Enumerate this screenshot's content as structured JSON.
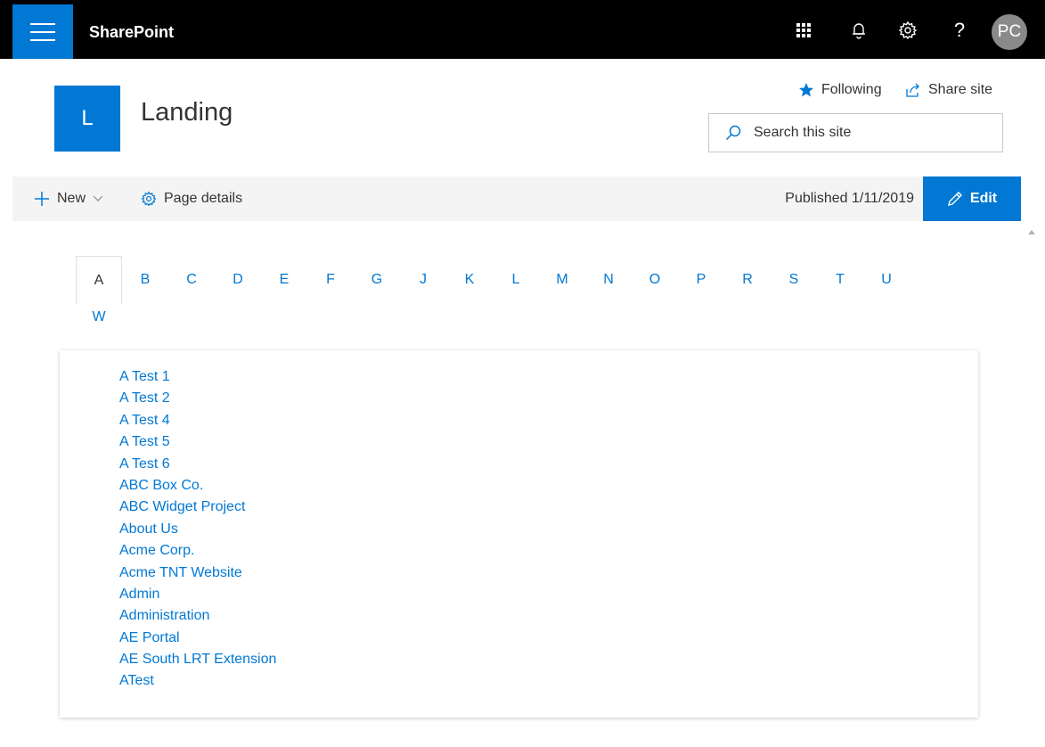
{
  "suitebar": {
    "app_name": "SharePoint",
    "user_initials": "PC",
    "icons": [
      "waffle-icon",
      "bell-icon",
      "gear-icon",
      "help-icon"
    ],
    "help_glyph": "?"
  },
  "site": {
    "logo_letter": "L",
    "title": "Landing",
    "follow_label": "Following",
    "share_label": "Share site",
    "search_placeholder": "Search this site"
  },
  "commandbar": {
    "new_label": "New",
    "page_details_label": "Page details",
    "published_text": "Published 1/11/2019",
    "edit_label": "Edit"
  },
  "letters": {
    "row1": [
      "A",
      "B",
      "C",
      "D",
      "E",
      "F",
      "G",
      "J",
      "K",
      "L",
      "M",
      "N",
      "O",
      "P",
      "R",
      "S",
      "T",
      "U"
    ],
    "row2": [
      "W"
    ],
    "selected": "A"
  },
  "directory": {
    "items": [
      "A Test 1",
      "A Test 2",
      "A Test 4",
      "A Test 5",
      "A Test 6",
      "ABC Box Co.",
      "ABC Widget Project",
      "About Us",
      "Acme Corp.",
      "Acme TNT Website",
      "Admin",
      "Administration",
      "AE Portal",
      "AE South LRT Extension",
      "ATest"
    ]
  },
  "colors": {
    "accent": "#0078d4",
    "suitebar": "#000000",
    "commandbar": "#f4f4f4",
    "avatar": "#8a8a8a"
  }
}
